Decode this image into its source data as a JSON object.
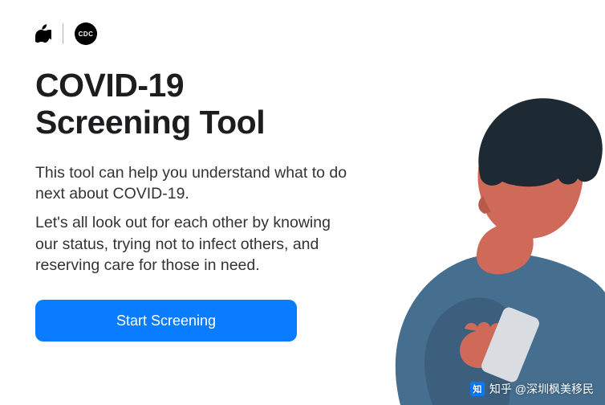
{
  "logos": {
    "apple_name": "apple-logo",
    "cdc_name": "cdc-logo",
    "cdc_text": "CDC"
  },
  "heading": "COVID-19\nScreening Tool",
  "lead": "This tool can help you understand what to do next about COVID-19.",
  "body": "Let's all look out for each other by knowing our status, trying not to infect others, and reserving care for those in need.",
  "cta_label": "Start Screening",
  "illustration_alt": "Person looking at a smartphone",
  "watermark": {
    "badge": "知",
    "text": "知乎 @深圳枫美移民"
  }
}
